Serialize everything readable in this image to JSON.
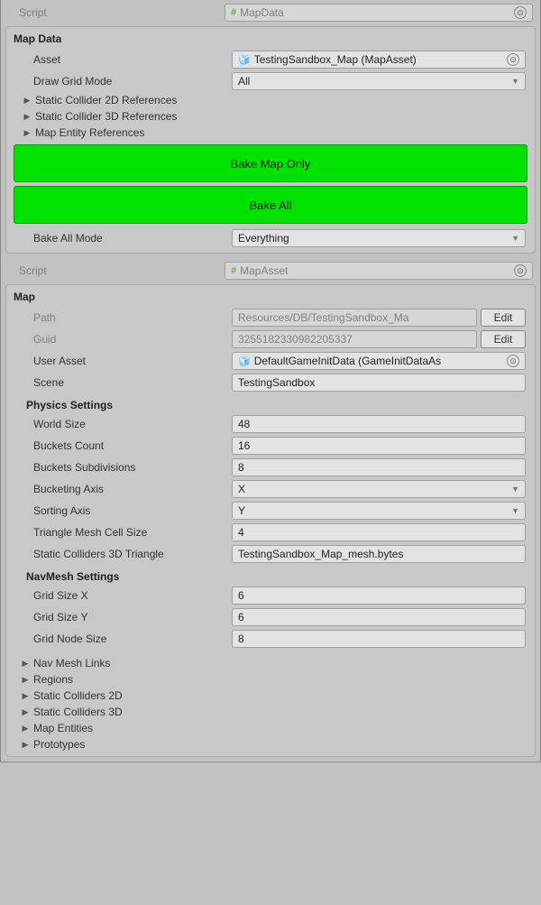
{
  "scriptRow1": {
    "label": "Script",
    "value": "MapData"
  },
  "mapdata_header": "Map Data",
  "asset": {
    "label": "Asset",
    "value": "TestingSandbox_Map (MapAsset)"
  },
  "drawGridMode": {
    "label": "Draw Grid Mode",
    "value": "All"
  },
  "foldouts1": {
    "s2d": "Static Collider 2D References",
    "s3d": "Static Collider 3D References",
    "ent": "Map Entity References"
  },
  "bakeMapOnly": "Bake Map Only",
  "bakeAll": "Bake All",
  "bakeAllMode": {
    "label": "Bake All Mode",
    "value": "Everything"
  },
  "scriptRow2": {
    "label": "Script",
    "value": "MapAsset"
  },
  "map_header": "Map",
  "path": {
    "label": "Path",
    "value": "Resources/DB/TestingSandbox_Ma",
    "edit": "Edit"
  },
  "guid": {
    "label": "Guid",
    "value": "3255182330982205337",
    "edit": "Edit"
  },
  "userAsset": {
    "label": "User Asset",
    "value": "DefaultGameInitData (GameInitDataAs"
  },
  "scene": {
    "label": "Scene",
    "value": "TestingSandbox"
  },
  "physics_header": "Physics Settings",
  "worldSize": {
    "label": "World Size",
    "value": "48"
  },
  "bucketsCount": {
    "label": "Buckets Count",
    "value": "16"
  },
  "bucketsSubdiv": {
    "label": "Buckets Subdivisions",
    "value": "8"
  },
  "bucketingAxis": {
    "label": "Bucketing Axis",
    "value": "X"
  },
  "sortingAxis": {
    "label": "Sorting Axis",
    "value": "Y"
  },
  "triMeshCell": {
    "label": "Triangle Mesh Cell Size",
    "value": "4"
  },
  "staticTri": {
    "label": "Static Colliders 3D Triangle",
    "value": "TestingSandbox_Map_mesh.bytes"
  },
  "navmesh_header": "NavMesh Settings",
  "gridX": {
    "label": "Grid Size X",
    "value": "6"
  },
  "gridY": {
    "label": "Grid Size Y",
    "value": "6"
  },
  "gridNode": {
    "label": "Grid Node Size",
    "value": "8"
  },
  "foldouts2": {
    "nml": "Nav Mesh Links",
    "reg": "Regions",
    "s2d": "Static Colliders 2D",
    "s3d": "Static Colliders 3D",
    "ent": "Map Entities",
    "proto": "Prototypes"
  }
}
